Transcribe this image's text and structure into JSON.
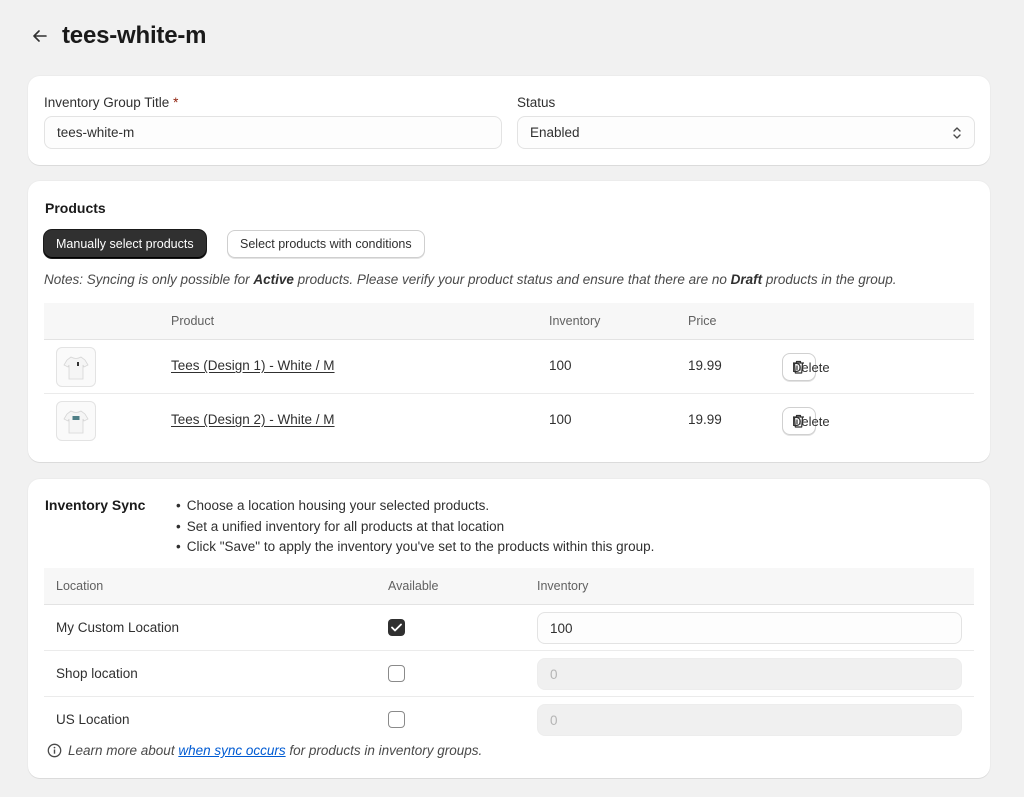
{
  "page": {
    "title": "tees-white-m",
    "back_icon": "arrow-left-icon"
  },
  "info": {
    "group_title_label": "Inventory Group Title",
    "required_mark": "*",
    "group_title_value": "tees-white-m",
    "status_label": "Status",
    "status_value": "Enabled"
  },
  "products": {
    "title": "Products",
    "manual_button": "Manually select products",
    "conditions_button": "Select products with conditions",
    "notes_prefix": "Notes: Syncing is only possible for ",
    "notes_active": "Active",
    "notes_middle": " products. Please verify your product status and ensure that there are no ",
    "notes_draft": "Draft",
    "notes_suffix": " products in the group.",
    "columns": {
      "product": "Product",
      "inventory": "Inventory",
      "price": "Price"
    },
    "rows": [
      {
        "name": "Tees (Design 1) - White / M",
        "inventory": "100",
        "price": "19.99",
        "delete": "Delete"
      },
      {
        "name": "Tees (Design 2) - White / M",
        "inventory": "100",
        "price": "19.99",
        "delete": "Delete"
      }
    ]
  },
  "sync": {
    "title": "Inventory Sync",
    "bullets": [
      "Choose a location housing your selected products.",
      "Set a unified inventory for all products at that location",
      "Click \"Save\" to apply the inventory you've set to the products within this group."
    ],
    "columns": {
      "location": "Location",
      "available": "Available",
      "inventory": "Inventory"
    },
    "rows": [
      {
        "location": "My Custom Location",
        "available": true,
        "inventory": "100"
      },
      {
        "location": "Shop location",
        "available": false,
        "inventory": "0"
      },
      {
        "location": "US Location",
        "available": false,
        "inventory": "0"
      }
    ],
    "learn_prefix": "Learn more about ",
    "learn_link": "when sync occurs",
    "learn_suffix": " for products in inventory groups."
  },
  "colors": {
    "background": "#f1f1f1",
    "primary_button": "#303030",
    "link": "#005bd3",
    "required": "#8e1f0b"
  }
}
